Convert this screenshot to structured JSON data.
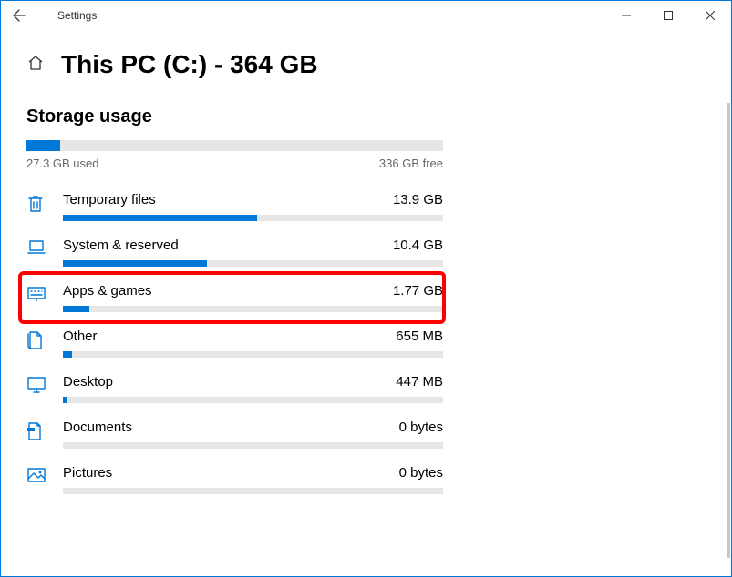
{
  "window": {
    "app_title": "Settings",
    "page_title": "This PC (C:) - 364 GB"
  },
  "storage": {
    "section_label": "Storage usage",
    "used_pct": 8,
    "used_label": "27.3 GB used",
    "free_label": "336 GB free"
  },
  "categories": [
    {
      "icon": "trash",
      "name": "Temporary files",
      "size": "13.9 GB",
      "pct": 51,
      "highlight": false
    },
    {
      "icon": "laptop",
      "name": "System & reserved",
      "size": "10.4 GB",
      "pct": 38,
      "highlight": false
    },
    {
      "icon": "keyboard",
      "name": "Apps & games",
      "size": "1.77 GB",
      "pct": 7,
      "highlight": true
    },
    {
      "icon": "file",
      "name": "Other",
      "size": "655 MB",
      "pct": 2.5,
      "highlight": false
    },
    {
      "icon": "monitor",
      "name": "Desktop",
      "size": "447 MB",
      "pct": 1,
      "highlight": false
    },
    {
      "icon": "document",
      "name": "Documents",
      "size": "0 bytes",
      "pct": 0,
      "highlight": false
    },
    {
      "icon": "picture",
      "name": "Pictures",
      "size": "0 bytes",
      "pct": 0,
      "highlight": false
    }
  ],
  "chart_data": {
    "type": "bar",
    "title": "Storage usage",
    "categories": [
      "Temporary files",
      "System & reserved",
      "Apps & games",
      "Other",
      "Desktop",
      "Documents",
      "Pictures"
    ],
    "values_label": [
      "13.9 GB",
      "10.4 GB",
      "1.77 GB",
      "655 MB",
      "447 MB",
      "0 bytes",
      "0 bytes"
    ],
    "overall": {
      "used": "27.3 GB",
      "free": "336 GB",
      "total": "364 GB"
    }
  }
}
